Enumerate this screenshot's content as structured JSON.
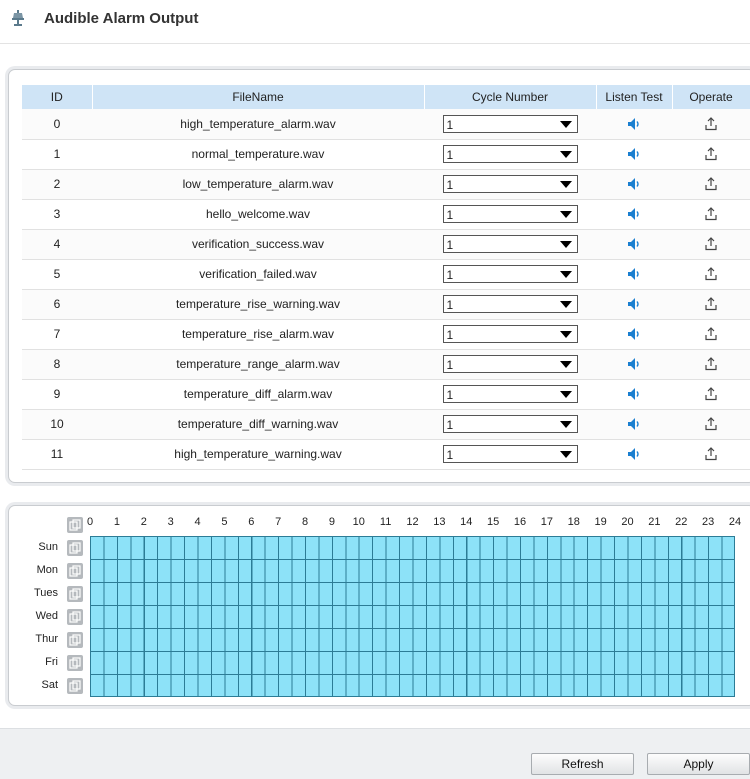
{
  "header": {
    "title": "Audible Alarm Output",
    "icon": "alarm-horn-icon"
  },
  "files": {
    "columns": {
      "id": "ID",
      "filename": "FileName",
      "cycle": "Cycle Number",
      "listen": "Listen Test",
      "operate": "Operate"
    },
    "rows": [
      {
        "id": "0",
        "filename": "high_temperature_alarm.wav",
        "cycle": "1"
      },
      {
        "id": "1",
        "filename": "normal_temperature.wav",
        "cycle": "1"
      },
      {
        "id": "2",
        "filename": "low_temperature_alarm.wav",
        "cycle": "1"
      },
      {
        "id": "3",
        "filename": "hello_welcome.wav",
        "cycle": "1"
      },
      {
        "id": "4",
        "filename": "verification_success.wav",
        "cycle": "1"
      },
      {
        "id": "5",
        "filename": "verification_failed.wav",
        "cycle": "1"
      },
      {
        "id": "6",
        "filename": "temperature_rise_warning.wav",
        "cycle": "1"
      },
      {
        "id": "7",
        "filename": "temperature_rise_alarm.wav",
        "cycle": "1"
      },
      {
        "id": "8",
        "filename": "temperature_range_alarm.wav",
        "cycle": "1"
      },
      {
        "id": "9",
        "filename": "temperature_diff_alarm.wav",
        "cycle": "1"
      },
      {
        "id": "10",
        "filename": "temperature_diff_warning.wav",
        "cycle": "1"
      },
      {
        "id": "11",
        "filename": "high_temperature_warning.wav",
        "cycle": "1"
      }
    ],
    "listen_icon": "speaker-icon",
    "operate_icon": "upload-icon"
  },
  "schedule": {
    "hours": [
      "0",
      "1",
      "2",
      "3",
      "4",
      "5",
      "6",
      "7",
      "8",
      "9",
      "10",
      "11",
      "12",
      "13",
      "14",
      "15",
      "16",
      "17",
      "18",
      "19",
      "20",
      "21",
      "22",
      "23",
      "24"
    ],
    "days": [
      "Sun",
      "Mon",
      "Tues",
      "Wed",
      "Thur",
      "Fri",
      "Sat"
    ],
    "copy_icon": "copy-icon",
    "all_armed": true,
    "cell_color": "#8de2f8"
  },
  "footer": {
    "refresh_label": "Refresh",
    "apply_label": "Apply"
  },
  "colors": {
    "header_bg": "#cfe4f6",
    "speaker": "#1a7fd0"
  }
}
